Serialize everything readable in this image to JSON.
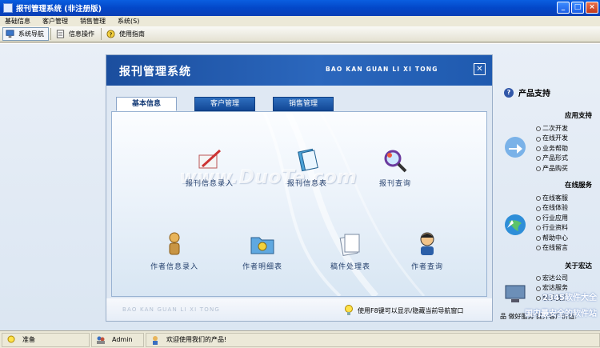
{
  "window": {
    "title": "报刊管理系统 (非注册版)",
    "controls": [
      "minimize",
      "maximize",
      "close"
    ]
  },
  "menu": [
    "基础信息",
    "客户管理",
    "销售管理",
    "系统(S)"
  ],
  "toolbar": [
    {
      "label": "系统导航",
      "icon": "monitor-icon"
    },
    {
      "label": "信息操作",
      "icon": "document-icon"
    },
    {
      "label": "使用指南",
      "icon": "help-icon"
    }
  ],
  "panel": {
    "title": "报刊管理系统",
    "subtitle": "BAO KAN GUAN LI XI TONG",
    "watermark": "www.DuoTe.com",
    "footer_subtitle": "BAO KAN GUAN LI XI TONG",
    "hint": "使用F8键可以显示/隐藏当前导航窗口",
    "tabs": [
      "基本信息",
      "客户管理",
      "销售管理"
    ],
    "active_tab": "基本信息",
    "items": [
      {
        "label": "报刊信息录入",
        "icon": "pen-icon"
      },
      {
        "label": "报刊信息表",
        "icon": "book-icon"
      },
      {
        "label": "报刊查询",
        "icon": "magnifier-icon"
      },
      {
        "label": "作者信息录入",
        "icon": "person-icon"
      },
      {
        "label": "作者明细表",
        "icon": "folder-icon"
      },
      {
        "label": "稿件处理表",
        "icon": "papers-icon"
      },
      {
        "label": "作者查询",
        "icon": "user-search-icon"
      }
    ]
  },
  "side": {
    "title": "产品支持",
    "sections": [
      {
        "title": "应用支持",
        "links": [
          "二次开发",
          "在线开发",
          "业务帮助",
          "产品形式",
          "产品购买"
        ]
      },
      {
        "title": "在线服务",
        "links": [
          "在线客服",
          "在线体验",
          "行业应用",
          "行业资料",
          "帮助中心",
          "在线留言"
        ]
      },
      {
        "title": "关于宏达",
        "links": [
          "宏达公司",
          "宏达服务",
          "联系我们"
        ]
      }
    ],
    "note": "品 做好服务 提升客户价值!"
  },
  "corner_watermark": {
    "line1": "2345软件大全",
    "line2": "国内最安全的软件站"
  },
  "status": {
    "ready": "准备",
    "user": "Admin",
    "welcome": "欢迎使用我们的产品!"
  },
  "colors": {
    "titlebar": "#0a5ee0",
    "panel_header": "#1f5aaf",
    "menubar": "#ece9d8"
  }
}
